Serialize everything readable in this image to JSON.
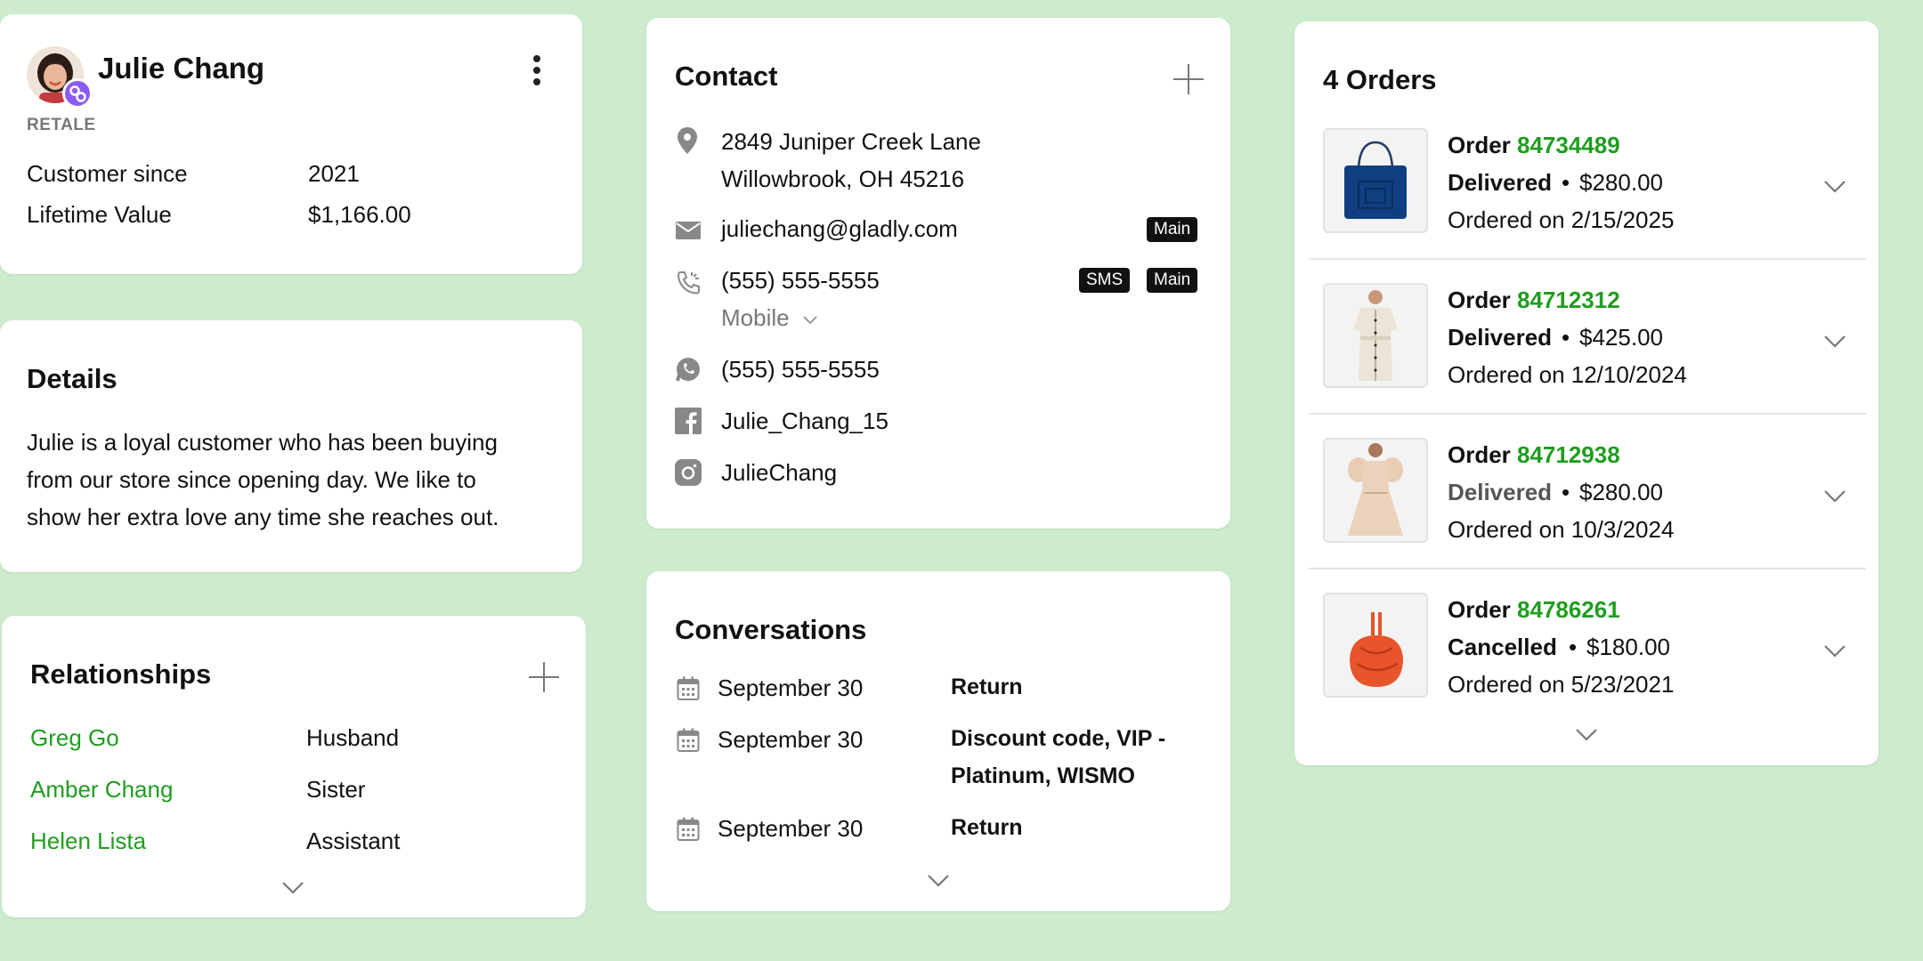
{
  "customer": {
    "name": "Julie Chang",
    "org": "RETALE",
    "since_label": "Customer since",
    "since_value": "2021",
    "ltv_label": "Lifetime Value",
    "ltv_value": "$1,166.00"
  },
  "details": {
    "title": "Details",
    "text_lines": [
      "Julie is a loyal customer who has been buying",
      "from our store since opening day. We like to",
      "show her extra love any time she reaches out."
    ]
  },
  "relationships": {
    "title": "Relationships",
    "items": [
      {
        "name": "Greg Go",
        "role": "Husband"
      },
      {
        "name": "Amber Chang",
        "role": "Sister"
      },
      {
        "name": "Helen Lista",
        "role": "Assistant"
      }
    ]
  },
  "contact": {
    "title": "Contact",
    "address_line1": "2849 Juniper Creek Lane",
    "address_line2": "Willowbrook, OH 45216",
    "email": "juliechang@gladly.com",
    "email_badge": "Main",
    "phone": "(555) 555-5555",
    "phone_badge_sms": "SMS",
    "phone_badge_main": "Main",
    "phone_type": "Mobile",
    "whatsapp": "(555) 555-5555",
    "facebook": "Julie_Chang_15",
    "instagram": "JulieChang"
  },
  "conversations": {
    "title": "Conversations",
    "items": [
      {
        "date": "September 30",
        "topic_line1": "Return",
        "topic_line2": ""
      },
      {
        "date": "September 30",
        "topic_line1": "Discount code, VIP -",
        "topic_line2": "Platinum, WISMO"
      },
      {
        "date": "September 30",
        "topic_line1": "Return",
        "topic_line2": ""
      }
    ]
  },
  "orders": {
    "title": "4 Orders",
    "order_label": "Order",
    "items": [
      {
        "number": "84734489",
        "status": "Delivered",
        "price": "$280.00",
        "ordered": "Ordered on 2/15/2025",
        "thumb": "blue-bag"
      },
      {
        "number": "84712312",
        "status": "Delivered",
        "price": "$425.00",
        "ordered": "Ordered on 12/10/2024",
        "thumb": "shirt-dress"
      },
      {
        "number": "84712938",
        "status": "Delivered",
        "price": "$280.00",
        "ordered": "Ordered on 10/3/2024",
        "thumb": "puff-dress"
      },
      {
        "number": "84786261",
        "status": "Cancelled",
        "price": "$180.00",
        "ordered": "Ordered on 5/23/2021",
        "thumb": "orange-bag"
      }
    ]
  },
  "colors": {
    "background": "#cdeccd",
    "link_green": "#1f9d1f",
    "badge": "#111111",
    "avatar_badge": "#8b5cf6"
  }
}
